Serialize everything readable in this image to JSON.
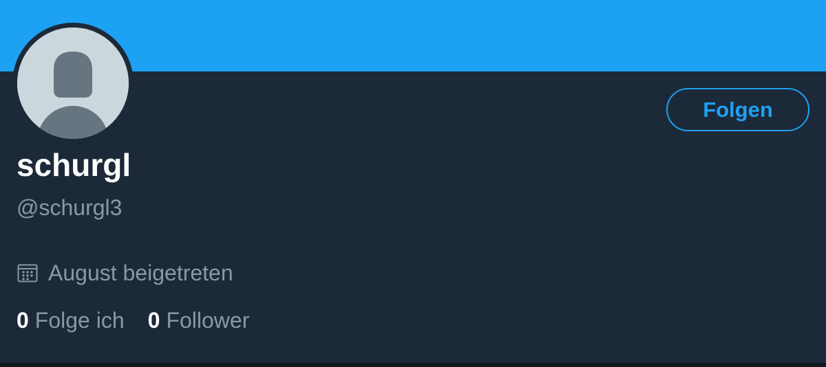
{
  "colors": {
    "banner": "#1da1f2",
    "background": "#1c2938",
    "accent": "#1da1f2",
    "secondary_text": "#8899a6",
    "primary_text": "#ffffff"
  },
  "profile": {
    "display_name": "schurgl",
    "handle": "@schurgl3",
    "avatar_icon": "default-avatar-icon",
    "joined_icon": "calendar-icon",
    "joined_text": "August beigetreten"
  },
  "actions": {
    "follow_label": "Folgen"
  },
  "stats": {
    "following_count": "0",
    "following_label": "Folge ich",
    "followers_count": "0",
    "followers_label": "Follower"
  }
}
